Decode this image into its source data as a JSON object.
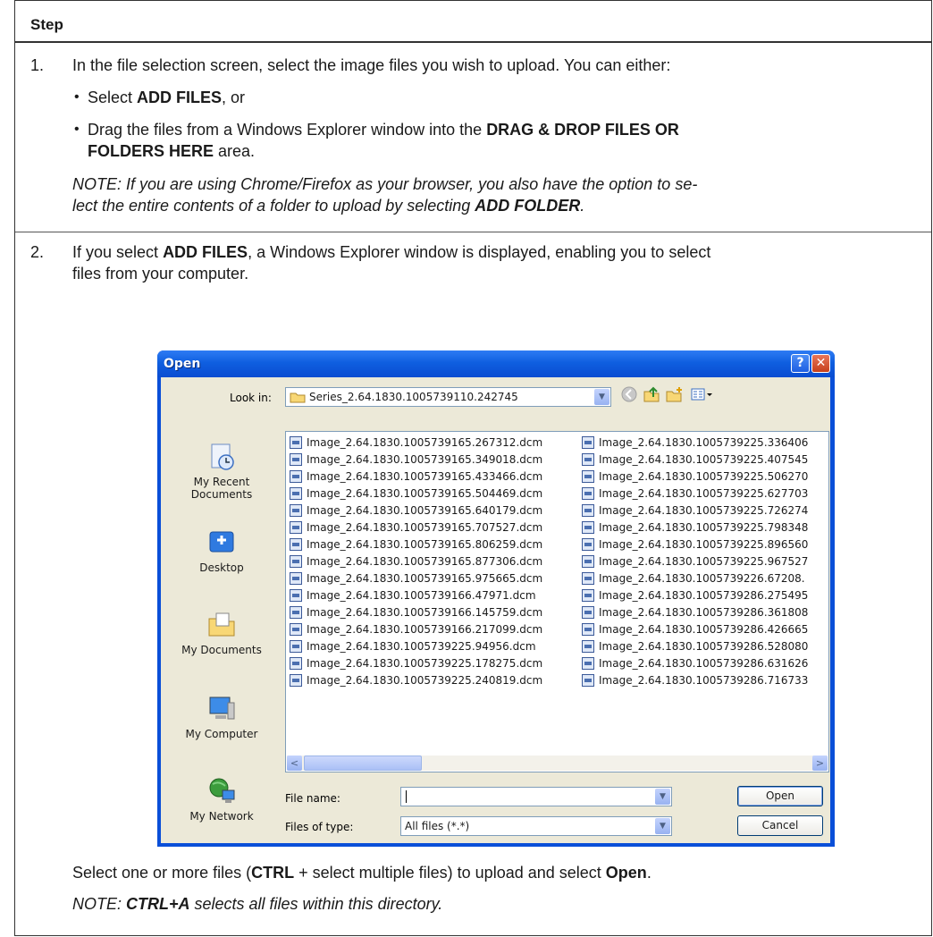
{
  "table": {
    "header": "Step",
    "step1": {
      "number": "1.",
      "intro": "In the file selection screen, select the image files you wish to upload. You can either:",
      "bullet1_a": "Select ",
      "bullet1_b": "ADD FILES",
      "bullet1_c": ", or",
      "bullet2_a": "Drag the files from a Windows Explorer window into the ",
      "bullet2_b": "DRAG & DROP FILES OR",
      "bullet2_c": "FOLDERS HERE",
      "bullet2_d": " area.",
      "note_line1": "NOTE: If you are using Chrome/Firefox as your browser, you also have the option to se-",
      "note_line2_a": "lect the entire contents of a folder to upload by selecting ",
      "note_line2_b": "ADD FOLDER",
      "note_line2_c": "."
    },
    "step2": {
      "number": "2.",
      "line1_a": "If you select ",
      "line1_b": "ADD FILES",
      "line1_c": ", a Windows Explorer window is displayed, enabling you to select",
      "line2": "files from your computer.",
      "after_a": "Select one or more files (",
      "after_b": "CTRL",
      "after_c": " + select multiple files) to upload and select ",
      "after_d": "Open",
      "after_e": ".",
      "note_a": "NOTE: ",
      "note_b": "CTRL+A",
      "note_c": " selects all files within this directory."
    }
  },
  "dialog": {
    "title": "Open",
    "help_glyph": "?",
    "close_glyph": "✕",
    "look_in_label": "Look in:",
    "look_in_value": "Series_2.64.1830.1005739110.242745",
    "places": [
      "My Recent Documents",
      "Desktop",
      "My Documents",
      "My Computer",
      "My Network"
    ],
    "files_col1": [
      "Image_2.64.1830.1005739165.267312.dcm",
      "Image_2.64.1830.1005739165.349018.dcm",
      "Image_2.64.1830.1005739165.433466.dcm",
      "Image_2.64.1830.1005739165.504469.dcm",
      "Image_2.64.1830.1005739165.640179.dcm",
      "Image_2.64.1830.1005739165.707527.dcm",
      "Image_2.64.1830.1005739165.806259.dcm",
      "Image_2.64.1830.1005739165.877306.dcm",
      "Image_2.64.1830.1005739165.975665.dcm",
      "Image_2.64.1830.1005739166.47971.dcm",
      "Image_2.64.1830.1005739166.145759.dcm",
      "Image_2.64.1830.1005739166.217099.dcm",
      "Image_2.64.1830.1005739225.94956.dcm",
      "Image_2.64.1830.1005739225.178275.dcm",
      "Image_2.64.1830.1005739225.240819.dcm"
    ],
    "files_col2": [
      "Image_2.64.1830.1005739225.336406",
      "Image_2.64.1830.1005739225.407545",
      "Image_2.64.1830.1005739225.506270",
      "Image_2.64.1830.1005739225.627703",
      "Image_2.64.1830.1005739225.726274",
      "Image_2.64.1830.1005739225.798348",
      "Image_2.64.1830.1005739225.896560",
      "Image_2.64.1830.1005739225.967527",
      "Image_2.64.1830.1005739226.67208.",
      "Image_2.64.1830.1005739286.275495",
      "Image_2.64.1830.1005739286.361808",
      "Image_2.64.1830.1005739286.426665",
      "Image_2.64.1830.1005739286.528080",
      "Image_2.64.1830.1005739286.631626",
      "Image_2.64.1830.1005739286.716733"
    ],
    "file_name_label": "File name:",
    "file_name_value": "",
    "files_of_type_label": "Files of type:",
    "files_of_type_value": "All files (*.*)",
    "open_button": "Open",
    "cancel_button": "Cancel",
    "scroll_left": "<",
    "scroll_right": ">",
    "combo_arrow": "▼",
    "colors": {
      "titlebar": "#0a4fd8",
      "client": "#ece9d8",
      "close": "#c6401c"
    }
  }
}
